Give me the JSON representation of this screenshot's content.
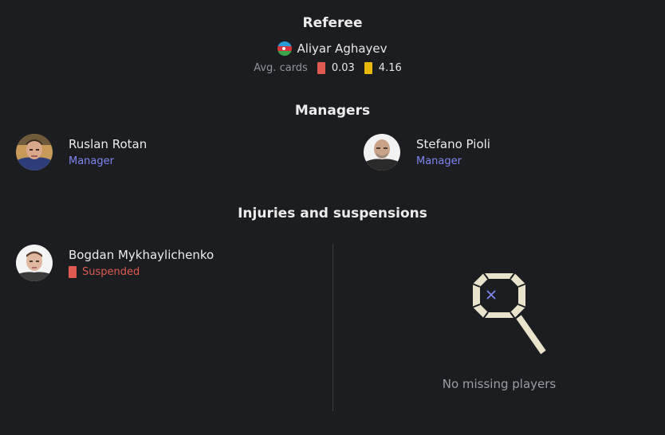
{
  "referee": {
    "title": "Referee",
    "name": "Aliyar Aghayev",
    "avg_cards_label": "Avg. cards",
    "red_avg": "0.03",
    "yellow_avg": "4.16"
  },
  "managers": {
    "title": "Managers",
    "list": [
      {
        "name": "Ruslan Rotan",
        "role": "Manager"
      },
      {
        "name": "Stefano Pioli",
        "role": "Manager"
      }
    ]
  },
  "injuries": {
    "title": "Injuries and suspensions",
    "home": [
      {
        "name": "Bogdan Mykhaylichenko",
        "status": "Suspended"
      }
    ],
    "away_empty_text": "No missing players"
  },
  "colors": {
    "background": "#1b1d20",
    "accent_role": "#7f86f2",
    "red_card": "#e05a4f",
    "yellow_card": "#e8b90a"
  }
}
